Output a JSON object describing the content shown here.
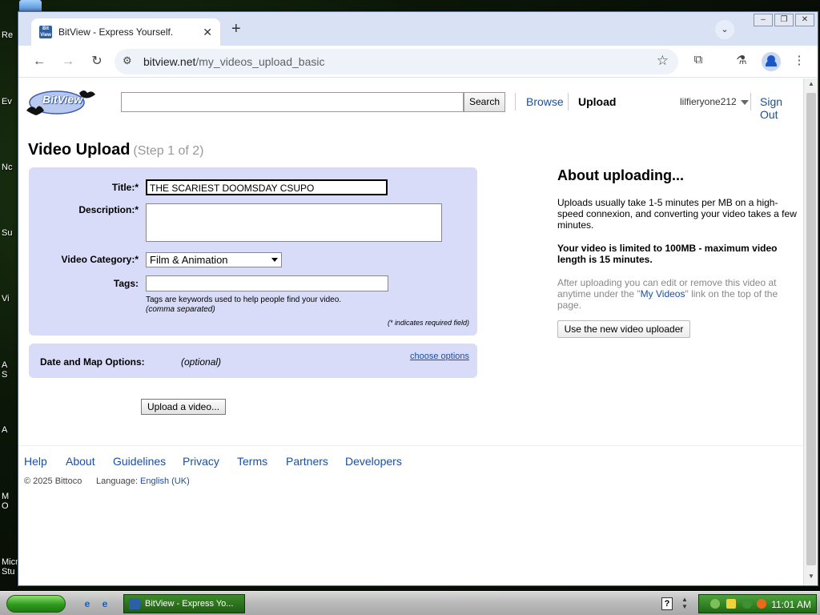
{
  "desktop": {
    "labels": [
      "Re",
      "Ev",
      "Nc",
      "Su",
      "Vi",
      "A",
      "S",
      "A",
      "M",
      "O",
      "Micr",
      "Stu"
    ]
  },
  "browser": {
    "tab_title": "BitView - Express Yourself.",
    "url_host": "bitview.net",
    "url_path": "/my_videos_upload_basic"
  },
  "header": {
    "logo_text": "BitView",
    "search_placeholder": "",
    "search_button": "Search",
    "nav": {
      "browse": "Browse",
      "upload": "Upload"
    },
    "username": "lilfieryone212",
    "sign_out": "Sign Out"
  },
  "main": {
    "heading": "Video Upload",
    "step": "(Step 1 of 2)",
    "form": {
      "title_label": "Title:*",
      "title_value": "THE SCARIEST DOOMSDAY CSUPO",
      "description_label": "Description:*",
      "description_value": "",
      "category_label": "Video Category:*",
      "category_value": "Film & Animation",
      "tags_label": "Tags:",
      "tags_value": "",
      "tags_hint": "Tags are keywords used to help people find your video.",
      "tags_hint_italic": "(comma separated)",
      "required_note": "(* indicates required field)"
    },
    "options": {
      "label": "Date and Map Options:",
      "optional": "(optional)",
      "link": "choose options"
    },
    "upload_button": "Upload a video..."
  },
  "about": {
    "title": "About uploading...",
    "p1": "Uploads usually take 1-5 minutes per MB on a high-speed connexion, and converting your video takes a few minutes.",
    "p2": "Your video is limited to 100MB - maximum video length is 15 minutes.",
    "p3_before": "After uploading you can edit or remove this video at anytime under the \"",
    "p3_link": "My Videos",
    "p3_after": "\" link on the top of the page.",
    "new_uploader_button": "Use the new video uploader"
  },
  "footer": {
    "links": [
      "Help",
      "About",
      "Guidelines",
      "Privacy",
      "Terms",
      "Partners",
      "Developers"
    ],
    "copyright": "© 2025 Bittoco",
    "language_label": "Language:",
    "language_value": "English (UK)"
  },
  "taskbar": {
    "task_label": "BitView - Express Yo...",
    "clock": "11:01 AM"
  },
  "colors": {
    "panel": "#d9dcf8",
    "link": "#1a4fa0",
    "taskbar_green": "#216b14"
  }
}
